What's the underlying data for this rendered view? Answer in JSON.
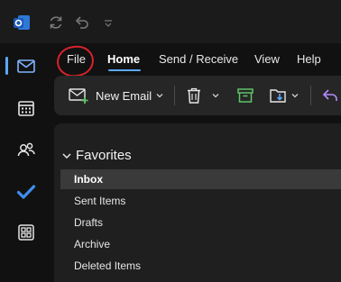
{
  "titlebar": {
    "icons": [
      "outlook-logo-icon",
      "sync-icon",
      "undo-icon",
      "customize-quick-access-icon"
    ]
  },
  "navrail": {
    "items": [
      {
        "name": "mail-icon",
        "active": true
      },
      {
        "name": "calendar-icon",
        "active": false
      },
      {
        "name": "people-icon",
        "active": false
      },
      {
        "name": "todo-icon",
        "active": false
      },
      {
        "name": "apps-icon",
        "active": false
      }
    ]
  },
  "tabs": {
    "file": "File",
    "home": "Home",
    "send_receive": "Send / Receive",
    "view": "View",
    "help": "Help",
    "active": "Home"
  },
  "ribbon": {
    "new_email": "New Email",
    "icons": [
      "new-email-icon",
      "delete-icon",
      "archive-icon",
      "move-icon",
      "reply-icon"
    ]
  },
  "folders": {
    "favorites_label": "Favorites",
    "items": [
      "Inbox",
      "Sent Items",
      "Drafts",
      "Archive",
      "Deleted Items"
    ],
    "selected": "Inbox"
  },
  "colors": {
    "accent": "#5aa9ff",
    "annotation": "#d9232b"
  }
}
